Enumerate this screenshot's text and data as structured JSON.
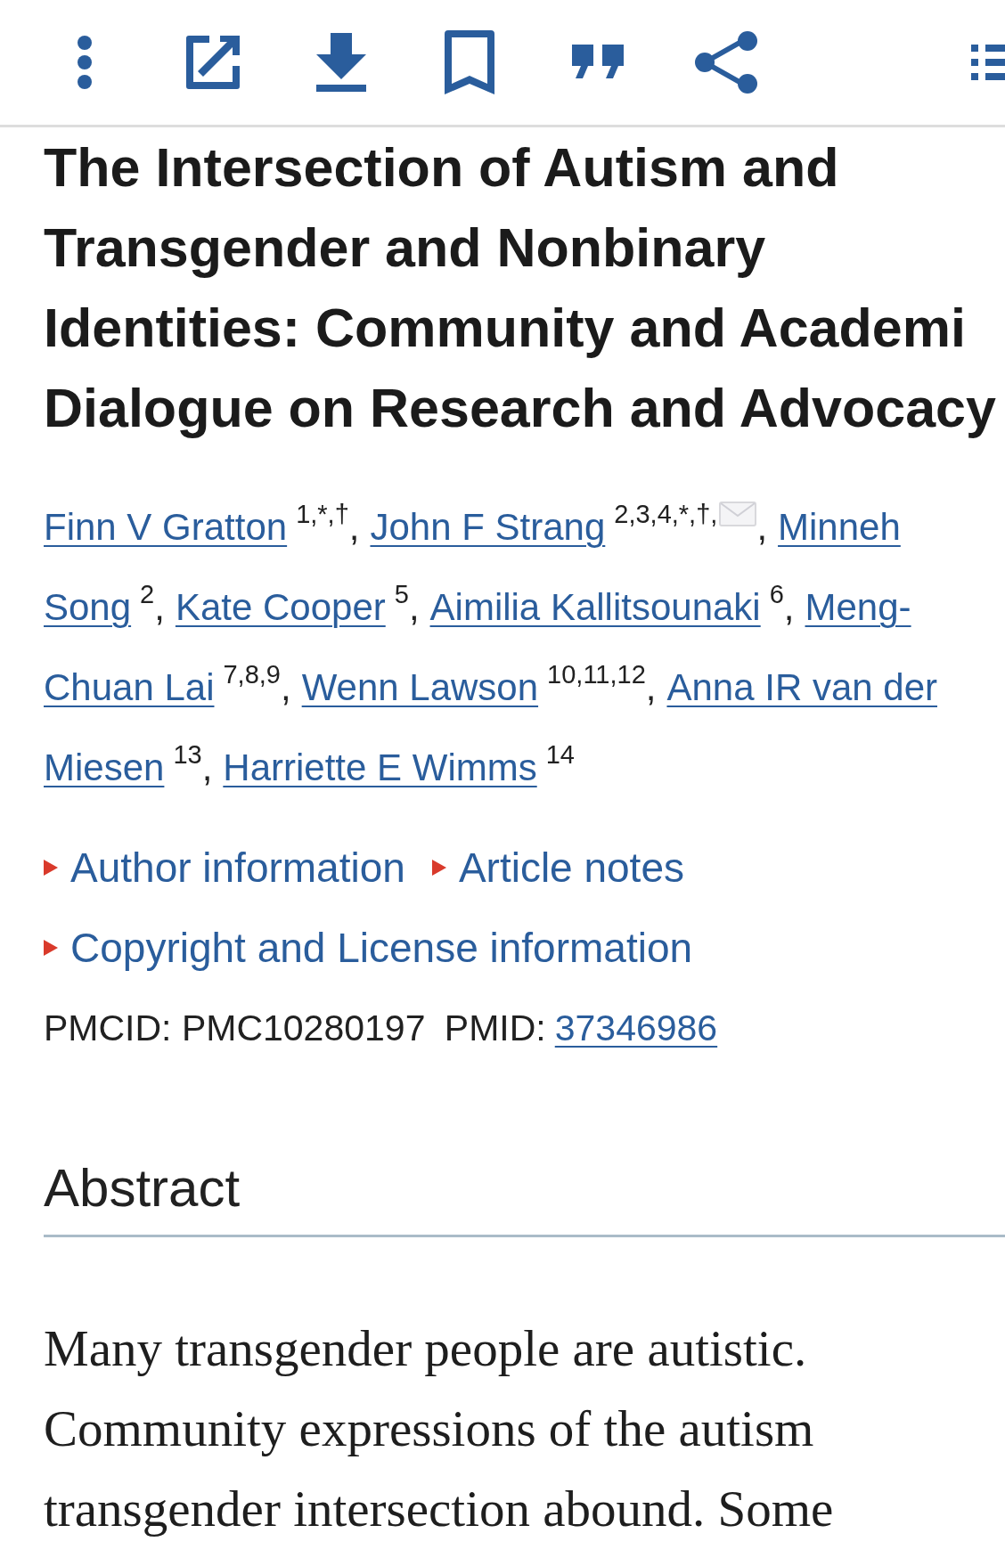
{
  "toolbar": {
    "items": [
      {
        "kind": "more"
      },
      {
        "kind": "external"
      },
      {
        "kind": "download"
      },
      {
        "kind": "bookmark"
      },
      {
        "kind": "cite"
      },
      {
        "kind": "share"
      },
      {
        "kind": "contents"
      }
    ]
  },
  "article": {
    "title_lines": [
      "The Intersection of Autism and",
      "Transgender and Nonbinary",
      "Identities: Community and Academi",
      "Dialogue on Research and Advocacy"
    ],
    "author_lines": [
      [
        {
          "kind": "name",
          "text": "Finn V Gratton"
        },
        {
          "kind": "sup",
          "text": "1,*,†"
        },
        {
          "kind": "sep",
          "text": ","
        },
        {
          "kind": "name",
          "text": "John F Strang"
        },
        {
          "kind": "sup",
          "text": "2,3,4,*,†,"
        },
        {
          "kind": "email"
        },
        {
          "kind": "sep",
          "text": ","
        },
        {
          "kind": "name",
          "text": "Minneh"
        }
      ],
      [
        {
          "kind": "name",
          "text": "Song"
        },
        {
          "kind": "sup",
          "text": "2"
        },
        {
          "kind": "sep",
          "text": ","
        },
        {
          "kind": "name",
          "text": "Kate Cooper"
        },
        {
          "kind": "sup",
          "text": "5"
        },
        {
          "kind": "sep",
          "text": ","
        },
        {
          "kind": "name",
          "text": "Aimilia Kallitsounaki"
        },
        {
          "kind": "sup",
          "text": "6"
        },
        {
          "kind": "sep",
          "text": ","
        },
        {
          "kind": "name",
          "text": "Meng-"
        }
      ],
      [
        {
          "kind": "name",
          "text": "Chuan Lai"
        },
        {
          "kind": "sup",
          "text": "7,8,9"
        },
        {
          "kind": "sep",
          "text": ","
        },
        {
          "kind": "name",
          "text": "Wenn Lawson"
        },
        {
          "kind": "sup",
          "text": "10,11,12"
        },
        {
          "kind": "sep",
          "text": ","
        },
        {
          "kind": "name",
          "text": "Anna IR van der"
        }
      ],
      [
        {
          "kind": "name",
          "text": "Miesen"
        },
        {
          "kind": "sup",
          "text": "13"
        },
        {
          "kind": "sep",
          "text": ","
        },
        {
          "kind": "name",
          "text": "Harriette E Wimms"
        },
        {
          "kind": "sup",
          "text": "14"
        }
      ]
    ],
    "expanders": [
      {
        "label": "Author information",
        "expanded": false
      },
      {
        "label": "Article notes",
        "expanded": false
      },
      {
        "label": "Copyright and License information",
        "expanded": false
      }
    ],
    "ids": {
      "pmcid_label": "PMCID:",
      "pmcid": "PMC10280197",
      "pmid_label": "PMID:",
      "pmid": "37346986"
    },
    "abstract": {
      "heading": "Abstract",
      "lines": [
        "Many transgender people are autistic.",
        "Community expressions of the autism",
        "transgender intersection abound. Some"
      ]
    }
  }
}
